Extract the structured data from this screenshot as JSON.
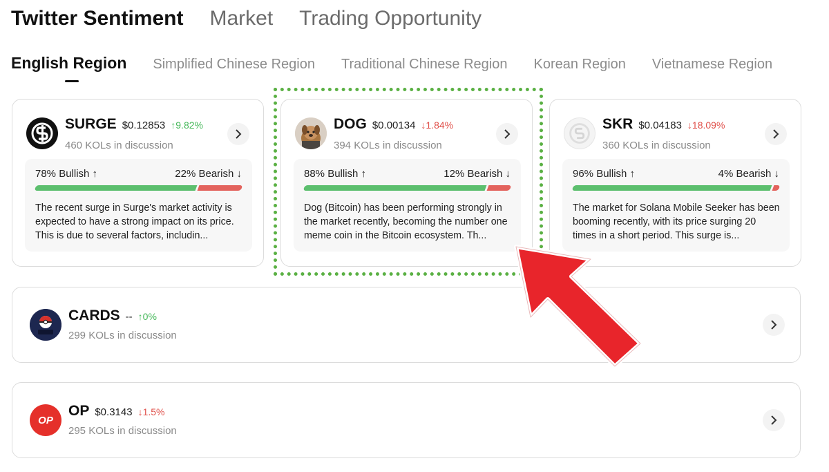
{
  "top_tabs": [
    {
      "label": "Twitter Sentiment",
      "active": true
    },
    {
      "label": "Market",
      "active": false
    },
    {
      "label": "Trading Opportunity",
      "active": false
    }
  ],
  "region_tabs": [
    {
      "label": "English Region",
      "active": true
    },
    {
      "label": "Simplified Chinese Region",
      "active": false
    },
    {
      "label": "Traditional Chinese Region",
      "active": false
    },
    {
      "label": "Korean Region",
      "active": false
    },
    {
      "label": "Vietnamese Region",
      "active": false
    }
  ],
  "cards": [
    {
      "symbol": "SURGE",
      "price": "$0.12853",
      "change": "↑9.82%",
      "direction": "up",
      "kols": "460 KOLs in discussion",
      "bullish": "78% Bullish ↑",
      "bearish": "22% Bearish ↓",
      "bullish_pct": 78,
      "description": "The recent surge in Surge's market activity is expected to have a strong impact on its price. This is due to several factors, includin..."
    },
    {
      "symbol": "DOG",
      "price": "$0.00134",
      "change": "↓1.84%",
      "direction": "down",
      "kols": "394 KOLs in discussion",
      "bullish": "88% Bullish ↑",
      "bearish": "12% Bearish ↓",
      "bullish_pct": 88,
      "description": "Dog (Bitcoin) has been performing strongly in the market recently, becoming the number one meme coin in the Bitcoin ecosystem. Th..."
    },
    {
      "symbol": "SKR",
      "price": "$0.04183",
      "change": "↓18.09%",
      "direction": "down",
      "kols": "360 KOLs in discussion",
      "bullish": "96% Bullish ↑",
      "bearish": "4% Bearish ↓",
      "bullish_pct": 96,
      "description": "The market for Solana Mobile Seeker has been booming recently, with its price surging 20 times in a short period. This surge is..."
    }
  ],
  "rows": [
    {
      "symbol": "CARDS",
      "price": "--",
      "change": "↑0%",
      "direction": "up",
      "kols": "299 KOLs in discussion",
      "logo_text": "CARDS"
    },
    {
      "symbol": "OP",
      "price": "$0.3143",
      "change": "↓1.5%",
      "direction": "down",
      "kols": "295 KOLs in discussion",
      "logo_text": "OP"
    }
  ],
  "colors": {
    "bullish": "#5cbf6e",
    "bearish": "#e3635d",
    "highlight": "#5ab043",
    "arrow": "#e8252b"
  }
}
